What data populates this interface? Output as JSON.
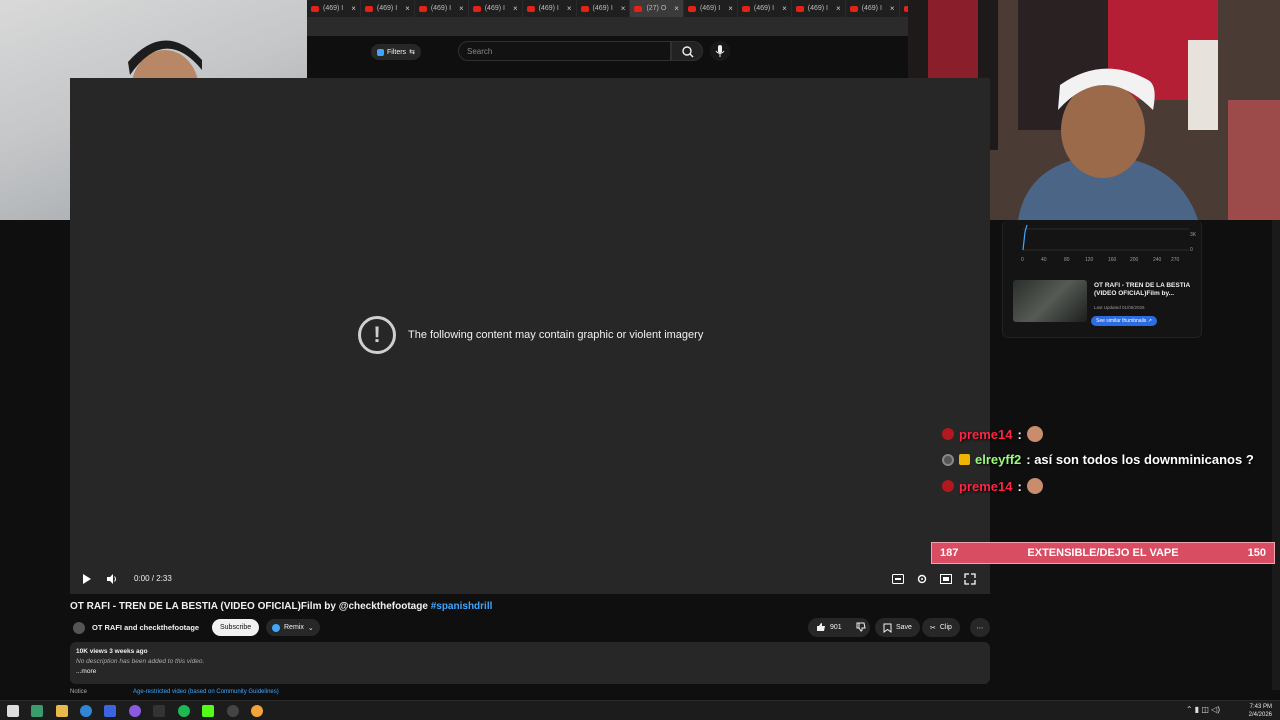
{
  "browser": {
    "tabs": [
      {
        "label": "(469) I",
        "active": false
      },
      {
        "label": "(469) I",
        "active": false
      },
      {
        "label": "(469) I",
        "active": false
      },
      {
        "label": "(469) I",
        "active": false
      },
      {
        "label": "(469) I",
        "active": false
      },
      {
        "label": "(469) I",
        "active": false
      },
      {
        "label": "(27) O",
        "active": true
      },
      {
        "label": "(469) I",
        "active": false
      },
      {
        "label": "(469) I",
        "active": false
      },
      {
        "label": "(469) I",
        "active": false
      },
      {
        "label": "(469) I",
        "active": false
      },
      {
        "label": "(469) I",
        "active": false
      },
      {
        "label": "(469) I",
        "active": false
      }
    ]
  },
  "header": {
    "filters_label": "Filters",
    "search_placeholder": "Search"
  },
  "player": {
    "warning_text": "The following content may contain graphic or violent imagery",
    "time": "0:00 / 2:33"
  },
  "side_panel": {
    "x_ticks": [
      "0",
      "40",
      "80",
      "120",
      "160",
      "200",
      "240",
      "270"
    ],
    "y_ticks": [
      "3K",
      "0"
    ],
    "card_title": "OT RAFI - TREN DE LA BESTIA (VIDEO OFICIAL)Film by...",
    "card_updated": "Last Updated 01/05/2026",
    "card_button": "See similar thumbnails"
  },
  "stream_chat": [
    {
      "user": "preme14",
      "message": "",
      "color": "#ff2442"
    },
    {
      "user": "elreyff2",
      "message": "así son todos los downminicanos ?",
      "color": "#9cfb7e"
    },
    {
      "user": "preme14",
      "message": "",
      "color": "#ff2442"
    }
  ],
  "prediction": {
    "left_count": "187",
    "label": "EXTENSIBLE/DEJO EL VAPE",
    "right_count": "150"
  },
  "video": {
    "title": "OT RAFI - TREN DE LA BESTIA (VIDEO OFICIAL)Film by @checkthefootage",
    "hashtag": "#spanishdrill",
    "channel": "OT RAFI and checkthefootage",
    "subscribe": "Subscribe",
    "remix": "Remix",
    "likes": "901",
    "save": "Save",
    "clip": "Clip",
    "views_line": "10K views  3 weeks ago",
    "no_description": "No description has been added to this video.",
    "more": "...more",
    "notice_label": "Notice",
    "notice_text": "Age-restricted video (based on Community Guidelines)"
  },
  "taskbar": {
    "time": "7:43 PM",
    "date": "2/4/2026"
  },
  "colors": {
    "youtube_red": "#e62117",
    "link_blue": "#3ea6ff",
    "prediction_pink": "#d84d62"
  }
}
